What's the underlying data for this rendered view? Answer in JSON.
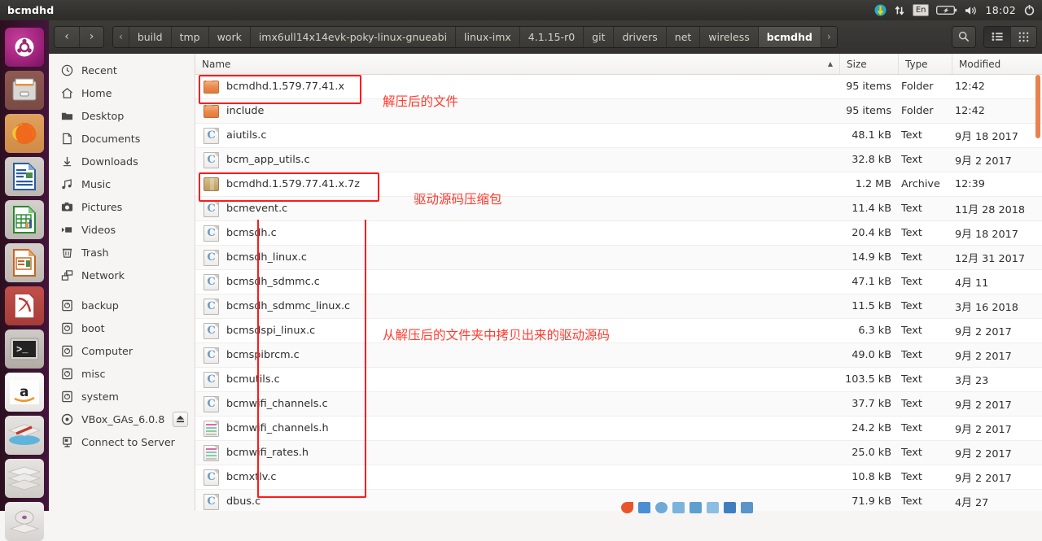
{
  "panel": {
    "title": "bcmdhd",
    "tray": {
      "update_icon": "update-available-icon",
      "network_icon": "network-transfer-icon",
      "keyboard_layout": "En",
      "battery_icon": "battery-icon",
      "volume_icon": "volume-icon",
      "clock": "18:02",
      "settings_icon": "system-settings-icon"
    }
  },
  "launcher": {
    "items": [
      {
        "name": "ubuntu-dash-icon",
        "label": "Ubuntu Dash",
        "cls": "ic-ubuntu",
        "glyph": ""
      },
      {
        "name": "files-icon",
        "label": "Files",
        "cls": "ic-files",
        "glyph": ""
      },
      {
        "name": "firefox-icon",
        "label": "Firefox",
        "cls": "ic-firefox",
        "glyph": ""
      },
      {
        "name": "libreoffice-writer-icon",
        "label": "LibreOffice Writer",
        "cls": "ic-writer",
        "glyph": ""
      },
      {
        "name": "libreoffice-calc-icon",
        "label": "LibreOffice Calc",
        "cls": "ic-calc",
        "glyph": ""
      },
      {
        "name": "libreoffice-impress-icon",
        "label": "LibreOffice Impress",
        "cls": "ic-impress",
        "glyph": ""
      },
      {
        "name": "pdf-viewer-icon",
        "label": "Document Viewer",
        "cls": "ic-pdf",
        "glyph": ""
      },
      {
        "name": "terminal-icon",
        "label": "Terminal",
        "cls": "ic-term",
        "glyph": ">_"
      },
      {
        "name": "amazon-icon",
        "label": "Amazon",
        "cls": "ic-amazon",
        "glyph": "a"
      },
      {
        "name": "software-updater-icon",
        "label": "Software Updater",
        "cls": "ic-stack",
        "glyph": ""
      },
      {
        "name": "workspace-stack-icon",
        "label": "Workspace",
        "cls": "ic-stack",
        "glyph": ""
      },
      {
        "name": "disc-icon",
        "label": "Disc",
        "cls": "ic-cd",
        "glyph": ""
      }
    ]
  },
  "headerbar": {
    "back_label": "‹",
    "forward_label": "›",
    "breadcrumb_prev": "‹",
    "breadcrumb_next": "›",
    "crumbs": [
      "build",
      "tmp",
      "work",
      "imx6ull14x14evk-poky-linux-gnueabi",
      "linux-imx",
      "4.1.15-r0",
      "git",
      "drivers",
      "net",
      "wireless",
      "bcmdhd"
    ],
    "active_crumb": "bcmdhd",
    "search_icon": "search-icon",
    "list-view_icon": "list-view-icon",
    "grid-view_icon": "grid-view-icon"
  },
  "sidebar": {
    "groups": [
      {
        "items": [
          {
            "label": "Recent",
            "icon": "clock-icon",
            "glyph": "◷"
          },
          {
            "label": "Home",
            "icon": "home-icon",
            "glyph": "⌂"
          },
          {
            "label": "Desktop",
            "icon": "desktop-folder-icon",
            "glyph": "▬"
          },
          {
            "label": "Documents",
            "icon": "documents-icon",
            "glyph": "□"
          },
          {
            "label": "Downloads",
            "icon": "downloads-icon",
            "glyph": "↓"
          },
          {
            "label": "Music",
            "icon": "music-icon",
            "glyph": "♫"
          },
          {
            "label": "Pictures",
            "icon": "pictures-icon",
            "glyph": "◎"
          },
          {
            "label": "Videos",
            "icon": "videos-icon",
            "glyph": "▶"
          },
          {
            "label": "Trash",
            "icon": "trash-icon",
            "glyph": "☒"
          },
          {
            "label": "Network",
            "icon": "network-icon",
            "glyph": "⊞"
          }
        ]
      },
      {
        "items": [
          {
            "label": "backup",
            "icon": "drive-icon",
            "glyph": "▣"
          },
          {
            "label": "boot",
            "icon": "drive-icon",
            "glyph": "▣"
          },
          {
            "label": "Computer",
            "icon": "drive-icon",
            "glyph": "▣"
          },
          {
            "label": "misc",
            "icon": "drive-icon",
            "glyph": "▣"
          },
          {
            "label": "system",
            "icon": "drive-icon",
            "glyph": "▣"
          },
          {
            "label": "VBox_GAs_6.0.8",
            "icon": "optical-disc-icon",
            "glyph": "◉",
            "eject": true
          },
          {
            "label": "Connect to Server",
            "icon": "connect-server-icon",
            "glyph": "⎕"
          }
        ]
      }
    ]
  },
  "columns": {
    "name": "Name",
    "size": "Size",
    "type": "Type",
    "modified": "Modified",
    "sort_arrow": "▲"
  },
  "files": [
    {
      "name": "bcmdhd.1.579.77.41.x",
      "icon": "folder",
      "size": "95 items",
      "type": "Folder",
      "modified": "12:42"
    },
    {
      "name": "include",
      "icon": "folder",
      "size": "95 items",
      "type": "Folder",
      "modified": "12:42"
    },
    {
      "name": "aiutils.c",
      "icon": "cfile",
      "size": "48.1 kB",
      "type": "Text",
      "modified": "9月 18 2017"
    },
    {
      "name": "bcm_app_utils.c",
      "icon": "cfile",
      "size": "32.8 kB",
      "type": "Text",
      "modified": "9月 2 2017"
    },
    {
      "name": "bcmdhd.1.579.77.41.x.7z",
      "icon": "archive",
      "size": "1.2 MB",
      "type": "Archive",
      "modified": "12:39"
    },
    {
      "name": "bcmevent.c",
      "icon": "cfile",
      "size": "11.4 kB",
      "type": "Text",
      "modified": "11月 28 2018"
    },
    {
      "name": "bcmsdh.c",
      "icon": "cfile",
      "size": "20.4 kB",
      "type": "Text",
      "modified": "9月 18 2017"
    },
    {
      "name": "bcmsdh_linux.c",
      "icon": "cfile",
      "size": "14.9 kB",
      "type": "Text",
      "modified": "12月 31 2017"
    },
    {
      "name": "bcmsdh_sdmmc.c",
      "icon": "cfile",
      "size": "47.1 kB",
      "type": "Text",
      "modified": "4月 11"
    },
    {
      "name": "bcmsdh_sdmmc_linux.c",
      "icon": "cfile",
      "size": "11.5 kB",
      "type": "Text",
      "modified": "3月 16 2018"
    },
    {
      "name": "bcmsdspi_linux.c",
      "icon": "cfile",
      "size": "6.3 kB",
      "type": "Text",
      "modified": "9月 2 2017"
    },
    {
      "name": "bcmspibrcm.c",
      "icon": "cfile",
      "size": "49.0 kB",
      "type": "Text",
      "modified": "9月 2 2017"
    },
    {
      "name": "bcmutils.c",
      "icon": "cfile",
      "size": "103.5 kB",
      "type": "Text",
      "modified": "3月 23"
    },
    {
      "name": "bcmwifi_channels.c",
      "icon": "cfile",
      "size": "37.7 kB",
      "type": "Text",
      "modified": "9月 2 2017"
    },
    {
      "name": "bcmwifi_channels.h",
      "icon": "hfile",
      "size": "24.2 kB",
      "type": "Text",
      "modified": "9月 2 2017"
    },
    {
      "name": "bcmwifi_rates.h",
      "icon": "hfile",
      "size": "25.0 kB",
      "type": "Text",
      "modified": "9月 2 2017"
    },
    {
      "name": "bcmxtlv.c",
      "icon": "cfile",
      "size": "10.8 kB",
      "type": "Text",
      "modified": "9月 2 2017"
    },
    {
      "name": "dbus.c",
      "icon": "cfile",
      "size": "71.9 kB",
      "type": "Text",
      "modified": "4月 27"
    }
  ],
  "annotations": {
    "color": "#ff3b2e",
    "extracted_folder_note": "解压后的文件",
    "archive_note": "驱动源码压缩包",
    "copied_sources_note": "从解压后的文件夹中拷贝出来的驱动源码"
  }
}
